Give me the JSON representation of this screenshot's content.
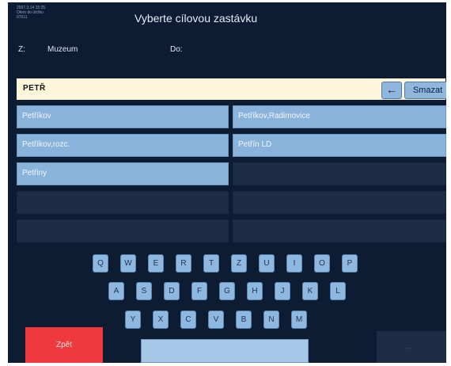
{
  "header": {
    "meta_lines": [
      "2007.3.14 15:25",
      "Okno do útržku",
      "07011"
    ],
    "title": "Vyberte cílovou zastávku"
  },
  "route": {
    "from_label": "Z:",
    "from_value": "Muzeum",
    "to_label": "Do:"
  },
  "search": {
    "value": "PETŘ",
    "backspace_label": "←",
    "clear_label": "Smazat"
  },
  "results": {
    "left": [
      "Petříkov",
      "Petříkov,rozc.",
      "Petřiny",
      "",
      ""
    ],
    "right": [
      "Petříkov,Radimovice",
      "Petřín LD",
      "",
      "",
      ""
    ]
  },
  "keyboard": {
    "rows": [
      [
        "Q",
        "W",
        "E",
        "R",
        "T",
        "Z",
        "U",
        "I",
        "O",
        "P"
      ],
      [
        "A",
        "S",
        "D",
        "F",
        "G",
        "H",
        "J",
        "K",
        "L"
      ],
      [
        "Y",
        "X",
        "C",
        "V",
        "B",
        "N",
        "M"
      ]
    ]
  },
  "footer": {
    "back_label": "Zpět",
    "next_label": "→"
  },
  "colors": {
    "background": "#0d1b33",
    "key": "#8fb8e0",
    "back_button": "#ee3a3f",
    "search_bg": "#fdf6da"
  }
}
